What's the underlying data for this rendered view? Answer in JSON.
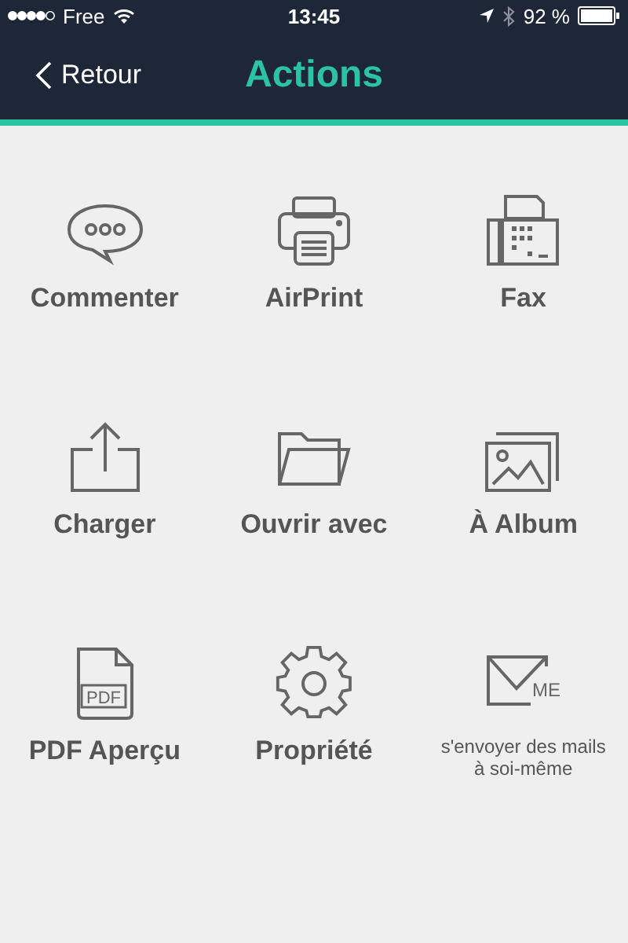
{
  "status_bar": {
    "carrier": "Free",
    "time": "13:45",
    "battery": "92 %"
  },
  "nav": {
    "back": "Retour",
    "title": "Actions"
  },
  "actions": [
    {
      "kind": "comment",
      "label": "Commenter"
    },
    {
      "kind": "print",
      "label": "AirPrint"
    },
    {
      "kind": "fax",
      "label": "Fax"
    },
    {
      "kind": "upload",
      "label": "Charger"
    },
    {
      "kind": "folder",
      "label": "Ouvrir avec"
    },
    {
      "kind": "album",
      "label": "À Album"
    },
    {
      "kind": "pdf",
      "label": "PDF Aperçu"
    },
    {
      "kind": "gear",
      "label": "Propriété"
    },
    {
      "kind": "mail",
      "label": "s'envoyer des mails à soi-même"
    }
  ],
  "icon_badges": [
    {
      "kind": "pdf",
      "text": "PDF"
    },
    {
      "kind": "mail",
      "text": "ME"
    }
  ]
}
